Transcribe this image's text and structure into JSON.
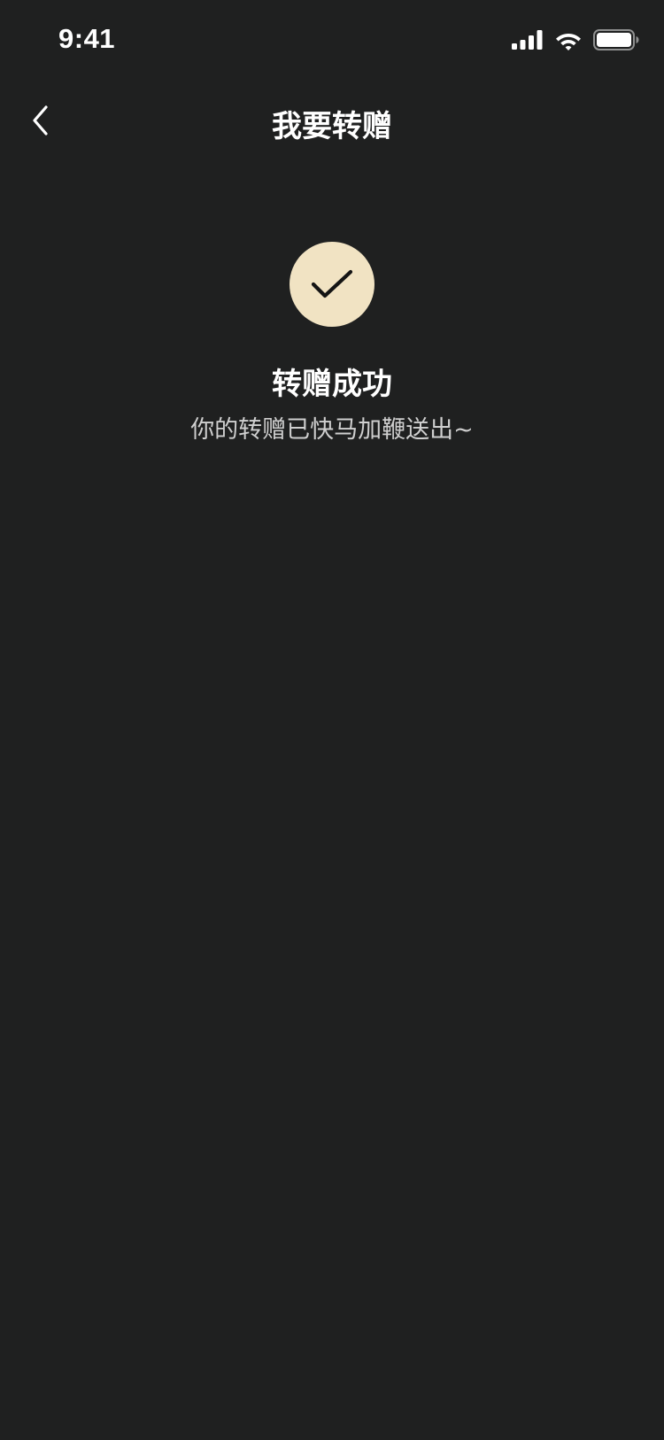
{
  "status_bar": {
    "time": "9:41",
    "icons": [
      "signal-icon",
      "wifi-icon",
      "battery-icon"
    ]
  },
  "nav": {
    "back_icon": "chevron-left-icon",
    "title": "我要转赠"
  },
  "result": {
    "icon": "checkmark-icon",
    "title": "转赠成功",
    "subtitle": "你的转赠已快马加鞭送出~"
  },
  "colors": {
    "background": "#1f2020",
    "accent_circle": "#f1e3c3",
    "text_primary": "#ffffff",
    "text_secondary": "#cfcfcf"
  }
}
